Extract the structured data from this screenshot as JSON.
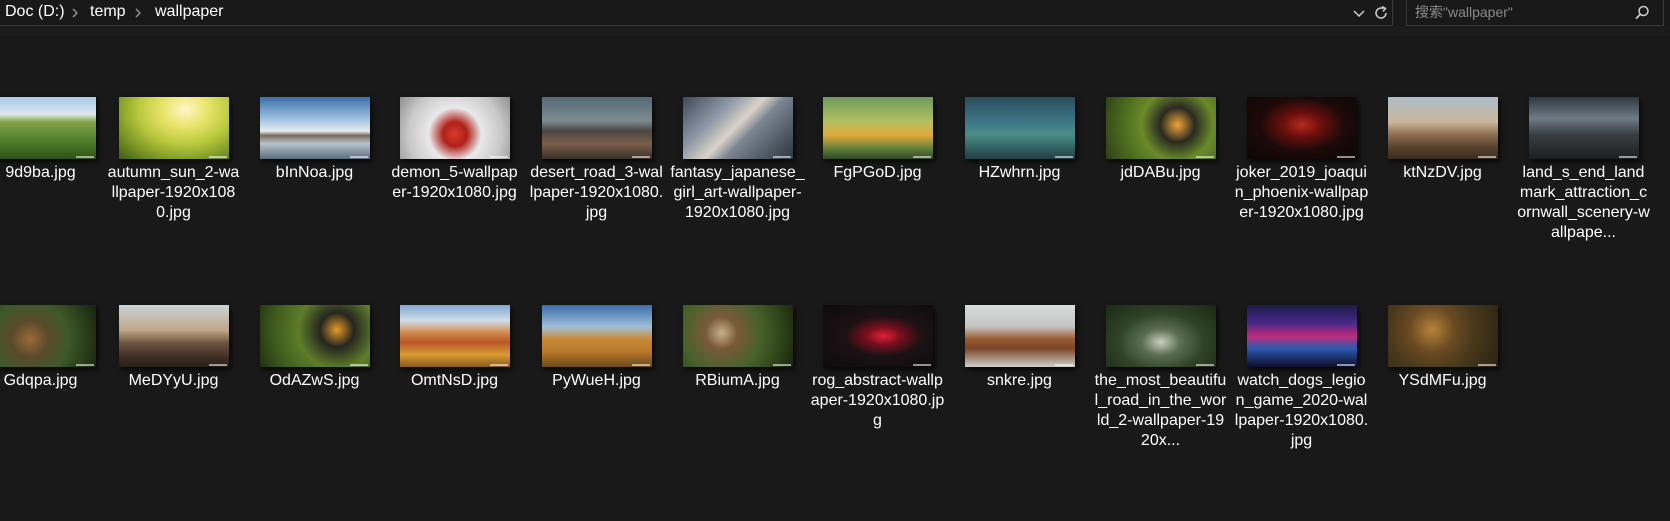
{
  "address_bar": {
    "crumbs": [
      "Doc (D:)",
      "temp",
      "wallpaper"
    ]
  },
  "search": {
    "placeholder": "搜索\"wallpaper\""
  },
  "icons": {
    "crumb_separator": "chevron-right-icon",
    "history_dropdown": "chevron-down-icon",
    "refresh": "refresh-icon",
    "search": "search-icon"
  },
  "colors": {
    "background": "#191919",
    "text": "#ffffff",
    "border": "#3a3a3a"
  },
  "files": [
    {
      "name": "9d9ba.jpg"
    },
    {
      "name": "autumn_sun_2-wallpaper-1920x1080.jpg"
    },
    {
      "name": "bInNoa.jpg"
    },
    {
      "name": "demon_5-wallpaper-1920x1080.jpg"
    },
    {
      "name": "desert_road_3-wallpaper-1920x1080.jpg"
    },
    {
      "name": "fantasy_japanese_girl_art-wallpaper-1920x1080.jpg"
    },
    {
      "name": "FgPGoD.jpg"
    },
    {
      "name": "HZwhrn.jpg"
    },
    {
      "name": "jdDABu.jpg"
    },
    {
      "name": "joker_2019_joaquin_phoenix-wallpaper-1920x1080.jpg"
    },
    {
      "name": "ktNzDV.jpg"
    },
    {
      "name": "land_s_end_landmark_attraction_cornwall_scenery-wallpape..."
    },
    {
      "name": "Gdqpa.jpg"
    },
    {
      "name": "MeDYyU.jpg"
    },
    {
      "name": "OdAZwS.jpg"
    },
    {
      "name": "OmtNsD.jpg"
    },
    {
      "name": "PyWueH.jpg"
    },
    {
      "name": "RBiumA.jpg"
    },
    {
      "name": "rog_abstract-wallpaper-1920x1080.jpg"
    },
    {
      "name": "snkre.jpg"
    },
    {
      "name": "the_most_beautiful_road_in_the_world_2-wallpaper-1920x..."
    },
    {
      "name": "watch_dogs_legion_game_2020-wallpaper-1920x1080.jpg"
    },
    {
      "name": "YSdMFu.jpg"
    }
  ]
}
